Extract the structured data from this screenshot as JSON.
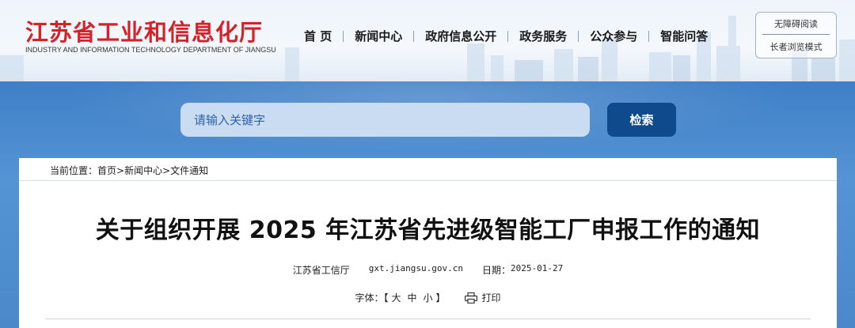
{
  "site": {
    "name_cn": "江苏省工业和信息化厅",
    "name_en": "INDUSTRY AND INFORMATION TECHNOLOGY DEPARTMENT OF JIANGSU"
  },
  "nav": [
    {
      "label": "首 页"
    },
    {
      "label": "新闻中心"
    },
    {
      "label": "政府信息公开"
    },
    {
      "label": "政务服务"
    },
    {
      "label": "公众参与"
    },
    {
      "label": "智能问答"
    }
  ],
  "accessibility": {
    "barrier_free": "无障碍阅读",
    "elder_mode": "长者浏览模式"
  },
  "search": {
    "placeholder": "请输入关键字",
    "button": "检索"
  },
  "breadcrumb": {
    "prefix": "当前位置：",
    "items": [
      "首页",
      "新闻中心",
      "文件通知"
    ],
    "separator": ">"
  },
  "article": {
    "title": "关于组织开展 2025 年江苏省先进级智能工厂申报工作的通知",
    "source": "江苏省工信厅",
    "domain": "gxt.jiangsu.gov.cn",
    "date_label": "日期：",
    "date": "2025-01-27"
  },
  "font_tools": {
    "label": "字体：【",
    "sizes": [
      "大",
      "中",
      "小"
    ],
    "close": "】",
    "print": "打印"
  },
  "colors": {
    "brand_red": "#d2232a",
    "button_blue": "#0f4a8c",
    "band_blue": "#4a88ca"
  }
}
